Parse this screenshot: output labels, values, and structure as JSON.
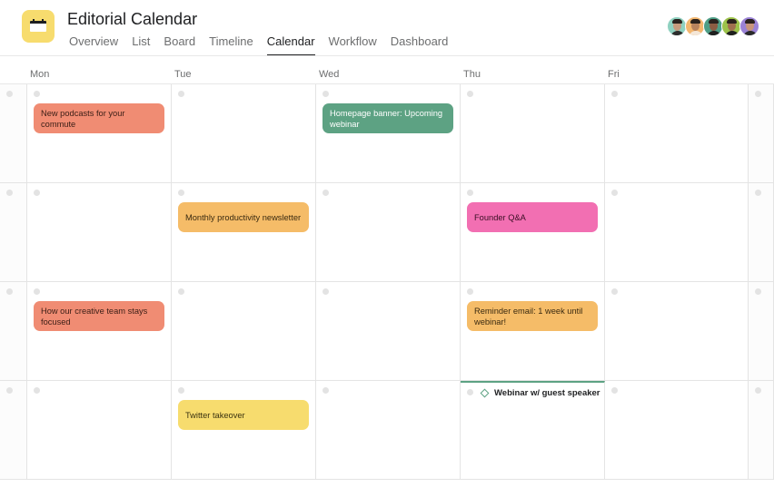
{
  "header": {
    "title": "Editorial Calendar",
    "app_icon": "calendar-icon",
    "app_icon_color": "#f7dc6e",
    "tabs": [
      {
        "label": "Overview",
        "active": false
      },
      {
        "label": "List",
        "active": false
      },
      {
        "label": "Board",
        "active": false
      },
      {
        "label": "Timeline",
        "active": false
      },
      {
        "label": "Calendar",
        "active": true
      },
      {
        "label": "Workflow",
        "active": false
      },
      {
        "label": "Dashboard",
        "active": false
      }
    ],
    "members": [
      {
        "bg": "#8fd1c0",
        "skin": "#c79a7d",
        "shirt": "#2d2d2d"
      },
      {
        "bg": "#f3b66e",
        "skin": "#b8835e",
        "shirt": "#f4e7d8"
      },
      {
        "bg": "#4e9e86",
        "skin": "#8c5c43",
        "shirt": "#1f1f1f"
      },
      {
        "bg": "#9cc24a",
        "skin": "#a0704f",
        "shirt": "#1f1f1f"
      },
      {
        "bg": "#9b82d6",
        "skin": "#c8957a",
        "shirt": "#2a2a2a"
      }
    ]
  },
  "calendar": {
    "days": [
      "Mon",
      "Tue",
      "Wed",
      "Thu",
      "Fri"
    ],
    "tasks": [
      {
        "week": 0,
        "day": 0,
        "label": "New podcasts for your commute",
        "color": "#f08c73",
        "text_color": "#3a1e16"
      },
      {
        "week": 0,
        "day": 2,
        "label": "Homepage banner: Upcoming webinar",
        "color": "#5da283",
        "text_color": "#ffffff"
      },
      {
        "week": 1,
        "day": 1,
        "label": "Monthly productivity newsletter",
        "color": "#f5bc68",
        "text_color": "#3a2a10"
      },
      {
        "week": 1,
        "day": 3,
        "label": "Founder Q&A",
        "color": "#f26fb2",
        "text_color": "#3a0f24"
      },
      {
        "week": 2,
        "day": 0,
        "label": "How our creative team stays focused",
        "color": "#f08c73",
        "text_color": "#3a1e16"
      },
      {
        "week": 2,
        "day": 3,
        "label": "Reminder email: 1 week until webinar!",
        "color": "#f5bc68",
        "text_color": "#3a2a10"
      },
      {
        "week": 3,
        "day": 1,
        "label": "Twitter takeover",
        "color": "#f7dc6e",
        "text_color": "#3a3210"
      }
    ],
    "milestones": [
      {
        "week": 3,
        "day": 3,
        "label": "Webinar w/ guest speaker",
        "icon": "diamond-milestone-icon",
        "color": "#5da283"
      }
    ]
  }
}
